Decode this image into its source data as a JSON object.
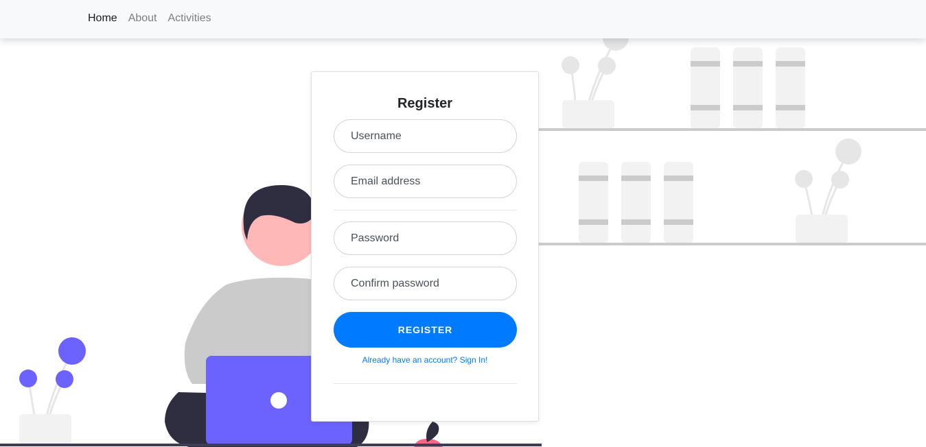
{
  "nav": {
    "items": [
      {
        "label": "Home",
        "active": true
      },
      {
        "label": "About",
        "active": false
      },
      {
        "label": "Activities",
        "active": false
      }
    ]
  },
  "register_card": {
    "title": "Register",
    "username_placeholder": "Username",
    "email_placeholder": "Email address",
    "password_placeholder": "Password",
    "confirm_placeholder": "Confirm password",
    "button_label": "REGISTER",
    "signin_link": "Already have an account? Sign In!"
  },
  "colors": {
    "primary": "#007bff",
    "navbar_bg": "#f8f9fa",
    "accent_purple": "#6c63ff",
    "skin": "#ffb8b8",
    "hair": "#2f2e41",
    "shirt": "#cbcbcb",
    "shelf_gray": "#f2f2f2"
  }
}
